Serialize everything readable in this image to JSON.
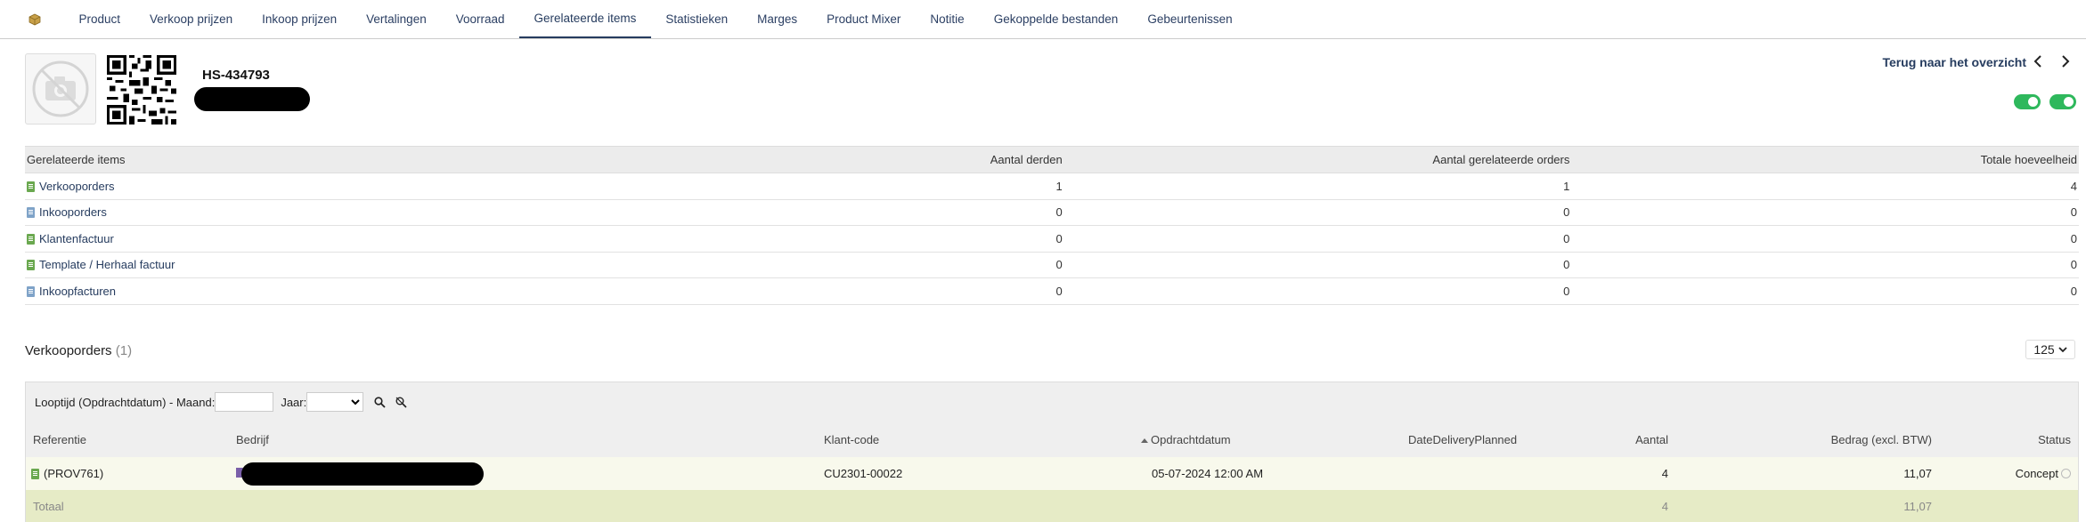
{
  "tabs": [
    {
      "label": "Product",
      "active": false
    },
    {
      "label": "Verkoop prijzen",
      "active": false
    },
    {
      "label": "Inkoop prijzen",
      "active": false
    },
    {
      "label": "Vertalingen",
      "active": false
    },
    {
      "label": "Voorraad",
      "active": false
    },
    {
      "label": "Gerelateerde items",
      "active": true
    },
    {
      "label": "Statistieken",
      "active": false
    },
    {
      "label": "Marges",
      "active": false
    },
    {
      "label": "Product Mixer",
      "active": false
    },
    {
      "label": "Notitie",
      "active": false
    },
    {
      "label": "Gekoppelde bestanden",
      "active": false
    },
    {
      "label": "Gebeurtenissen",
      "active": false
    }
  ],
  "header": {
    "ref": "HS-434793",
    "back_label": "Terug naar het overzicht",
    "icons": [
      "box-icon",
      "camera-off-icon",
      "qr-code",
      "chevron-left-icon",
      "chevron-right-icon"
    ],
    "toggles": [
      {
        "on": true
      },
      {
        "on": true
      }
    ]
  },
  "related": {
    "columns": [
      "Gerelateerde items",
      "Aantal derden",
      "Aantal gerelateerde orders",
      "Totale hoeveelheid"
    ],
    "rows": [
      {
        "label": "Verkooporders",
        "icon": "green",
        "third": "1",
        "orders": "1",
        "qty": "4"
      },
      {
        "label": "Inkooporders",
        "icon": "blue",
        "third": "0",
        "orders": "0",
        "qty": "0"
      },
      {
        "label": "Klantenfactuur",
        "icon": "green",
        "third": "0",
        "orders": "0",
        "qty": "0"
      },
      {
        "label": "Template / Herhaal factuur",
        "icon": "green",
        "third": "0",
        "orders": "0",
        "qty": "0"
      },
      {
        "label": "Inkoopfacturen",
        "icon": "blue",
        "third": "0",
        "orders": "0",
        "qty": "0"
      }
    ]
  },
  "orders": {
    "title": "Verkooporders",
    "count": "(1)",
    "page_size": "125",
    "filter": {
      "label": "Looptijd (Opdrachtdatum) - Maand:",
      "year_label": "Jaar:"
    },
    "columns": [
      "Referentie",
      "Bedrijf",
      "Klant-code",
      "Opdrachtdatum",
      "DateDeliveryPlanned",
      "Aantal",
      "Bedrag (excl. BTW)",
      "Status"
    ],
    "row": {
      "ref": "(PROV761)",
      "company": "",
      "client_code": "CU2301-00022",
      "date": "05-07-2024 12:00 AM",
      "delivery": "",
      "qty": "4",
      "amount": "11,07",
      "status": "Concept"
    },
    "total": {
      "label": "Totaal",
      "qty": "4",
      "amount": "11,07"
    }
  },
  "colors": {
    "accent": "#263c5f",
    "toggle_on": "#2eb85c",
    "row_highlight": "#f8f9ec",
    "total_row": "#e6ebc6"
  }
}
